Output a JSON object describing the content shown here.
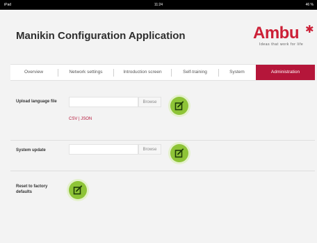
{
  "status_bar": {
    "carrier": "iPad",
    "time": "11:24",
    "battery": "46 %"
  },
  "app": {
    "title": "Manikin Configuration Application"
  },
  "logo": {
    "name": "Ambu",
    "tagline": "Ideas that work for life"
  },
  "tabs": [
    {
      "label": "Overview",
      "active": false
    },
    {
      "label": "Network settings",
      "active": false
    },
    {
      "label": "Introduction screen",
      "active": false
    },
    {
      "label": "Self-training",
      "active": false
    },
    {
      "label": "System",
      "active": false
    },
    {
      "label": "Administration",
      "active": true
    }
  ],
  "admin": {
    "upload_language": {
      "label": "Upload language file",
      "input_value": "",
      "browse_label": "Browse",
      "formats": "CSV | JSON"
    },
    "system_update": {
      "label": "System update",
      "input_value": "",
      "browse_label": "Browse"
    },
    "factory_reset": {
      "label": "Reset to factory defaults"
    }
  },
  "colors": {
    "accent": "#b5163a",
    "action": "#8ec437",
    "brand": "#cc1f36"
  }
}
